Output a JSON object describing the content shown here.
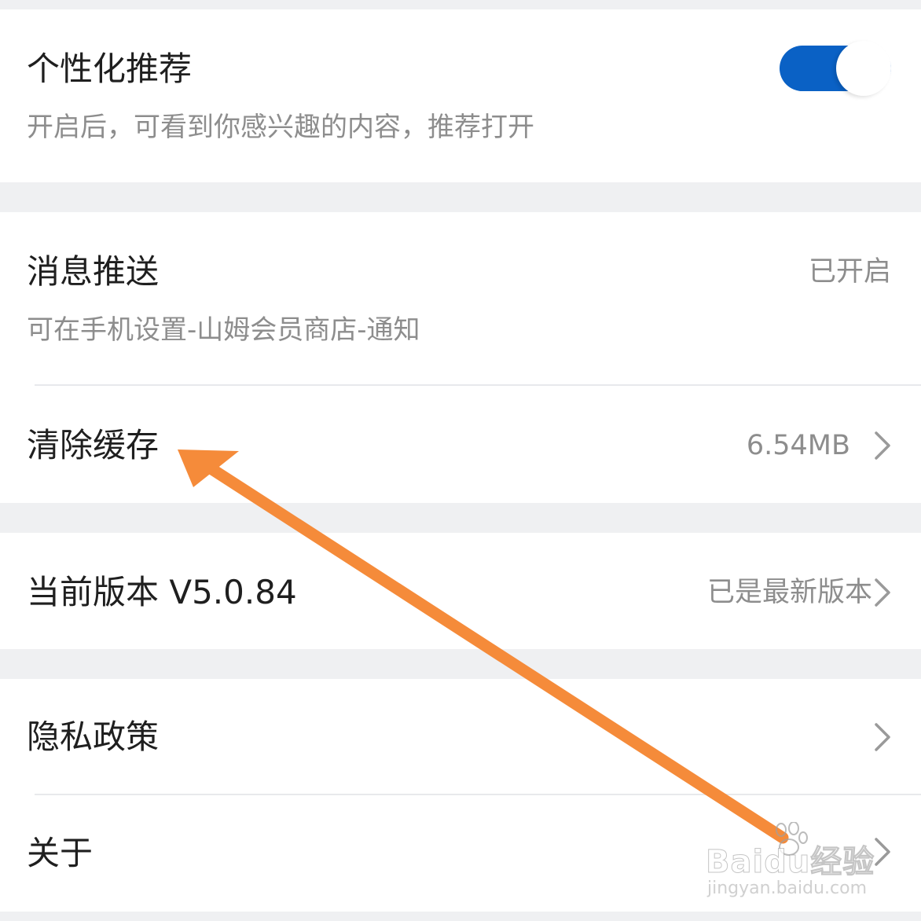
{
  "colors": {
    "background": "#eff0f2",
    "card": "#ffffff",
    "title_text": "#1f1f1f",
    "secondary_text": "#8d8d8d",
    "toggle_on": "#0a61c5",
    "annotation_arrow": "#f58b3a"
  },
  "settings": {
    "personalized": {
      "title": "个性化推荐",
      "subtitle": "开启后，可看到你感兴趣的内容，推荐打开",
      "toggle_state": "on"
    },
    "push": {
      "title": "消息推送",
      "value": "已开启",
      "subtitle": "可在手机设置-山姆会员商店-通知"
    },
    "cache": {
      "title": "清除缓存",
      "value": "6.54MB",
      "icon": "chevron-right-icon"
    },
    "version": {
      "title": "当前版本 V5.0.84",
      "value": "已是最新版本",
      "icon": "chevron-right-icon"
    },
    "privacy": {
      "title": "隐私政策",
      "icon": "chevron-right-icon"
    },
    "about": {
      "title": "关于",
      "icon": "chevron-right-icon"
    }
  },
  "annotation": {
    "type": "arrow",
    "points_to": "清除缓存"
  },
  "watermark": {
    "brand": "Baidu经验",
    "url": "jingyan.baidu.com"
  }
}
